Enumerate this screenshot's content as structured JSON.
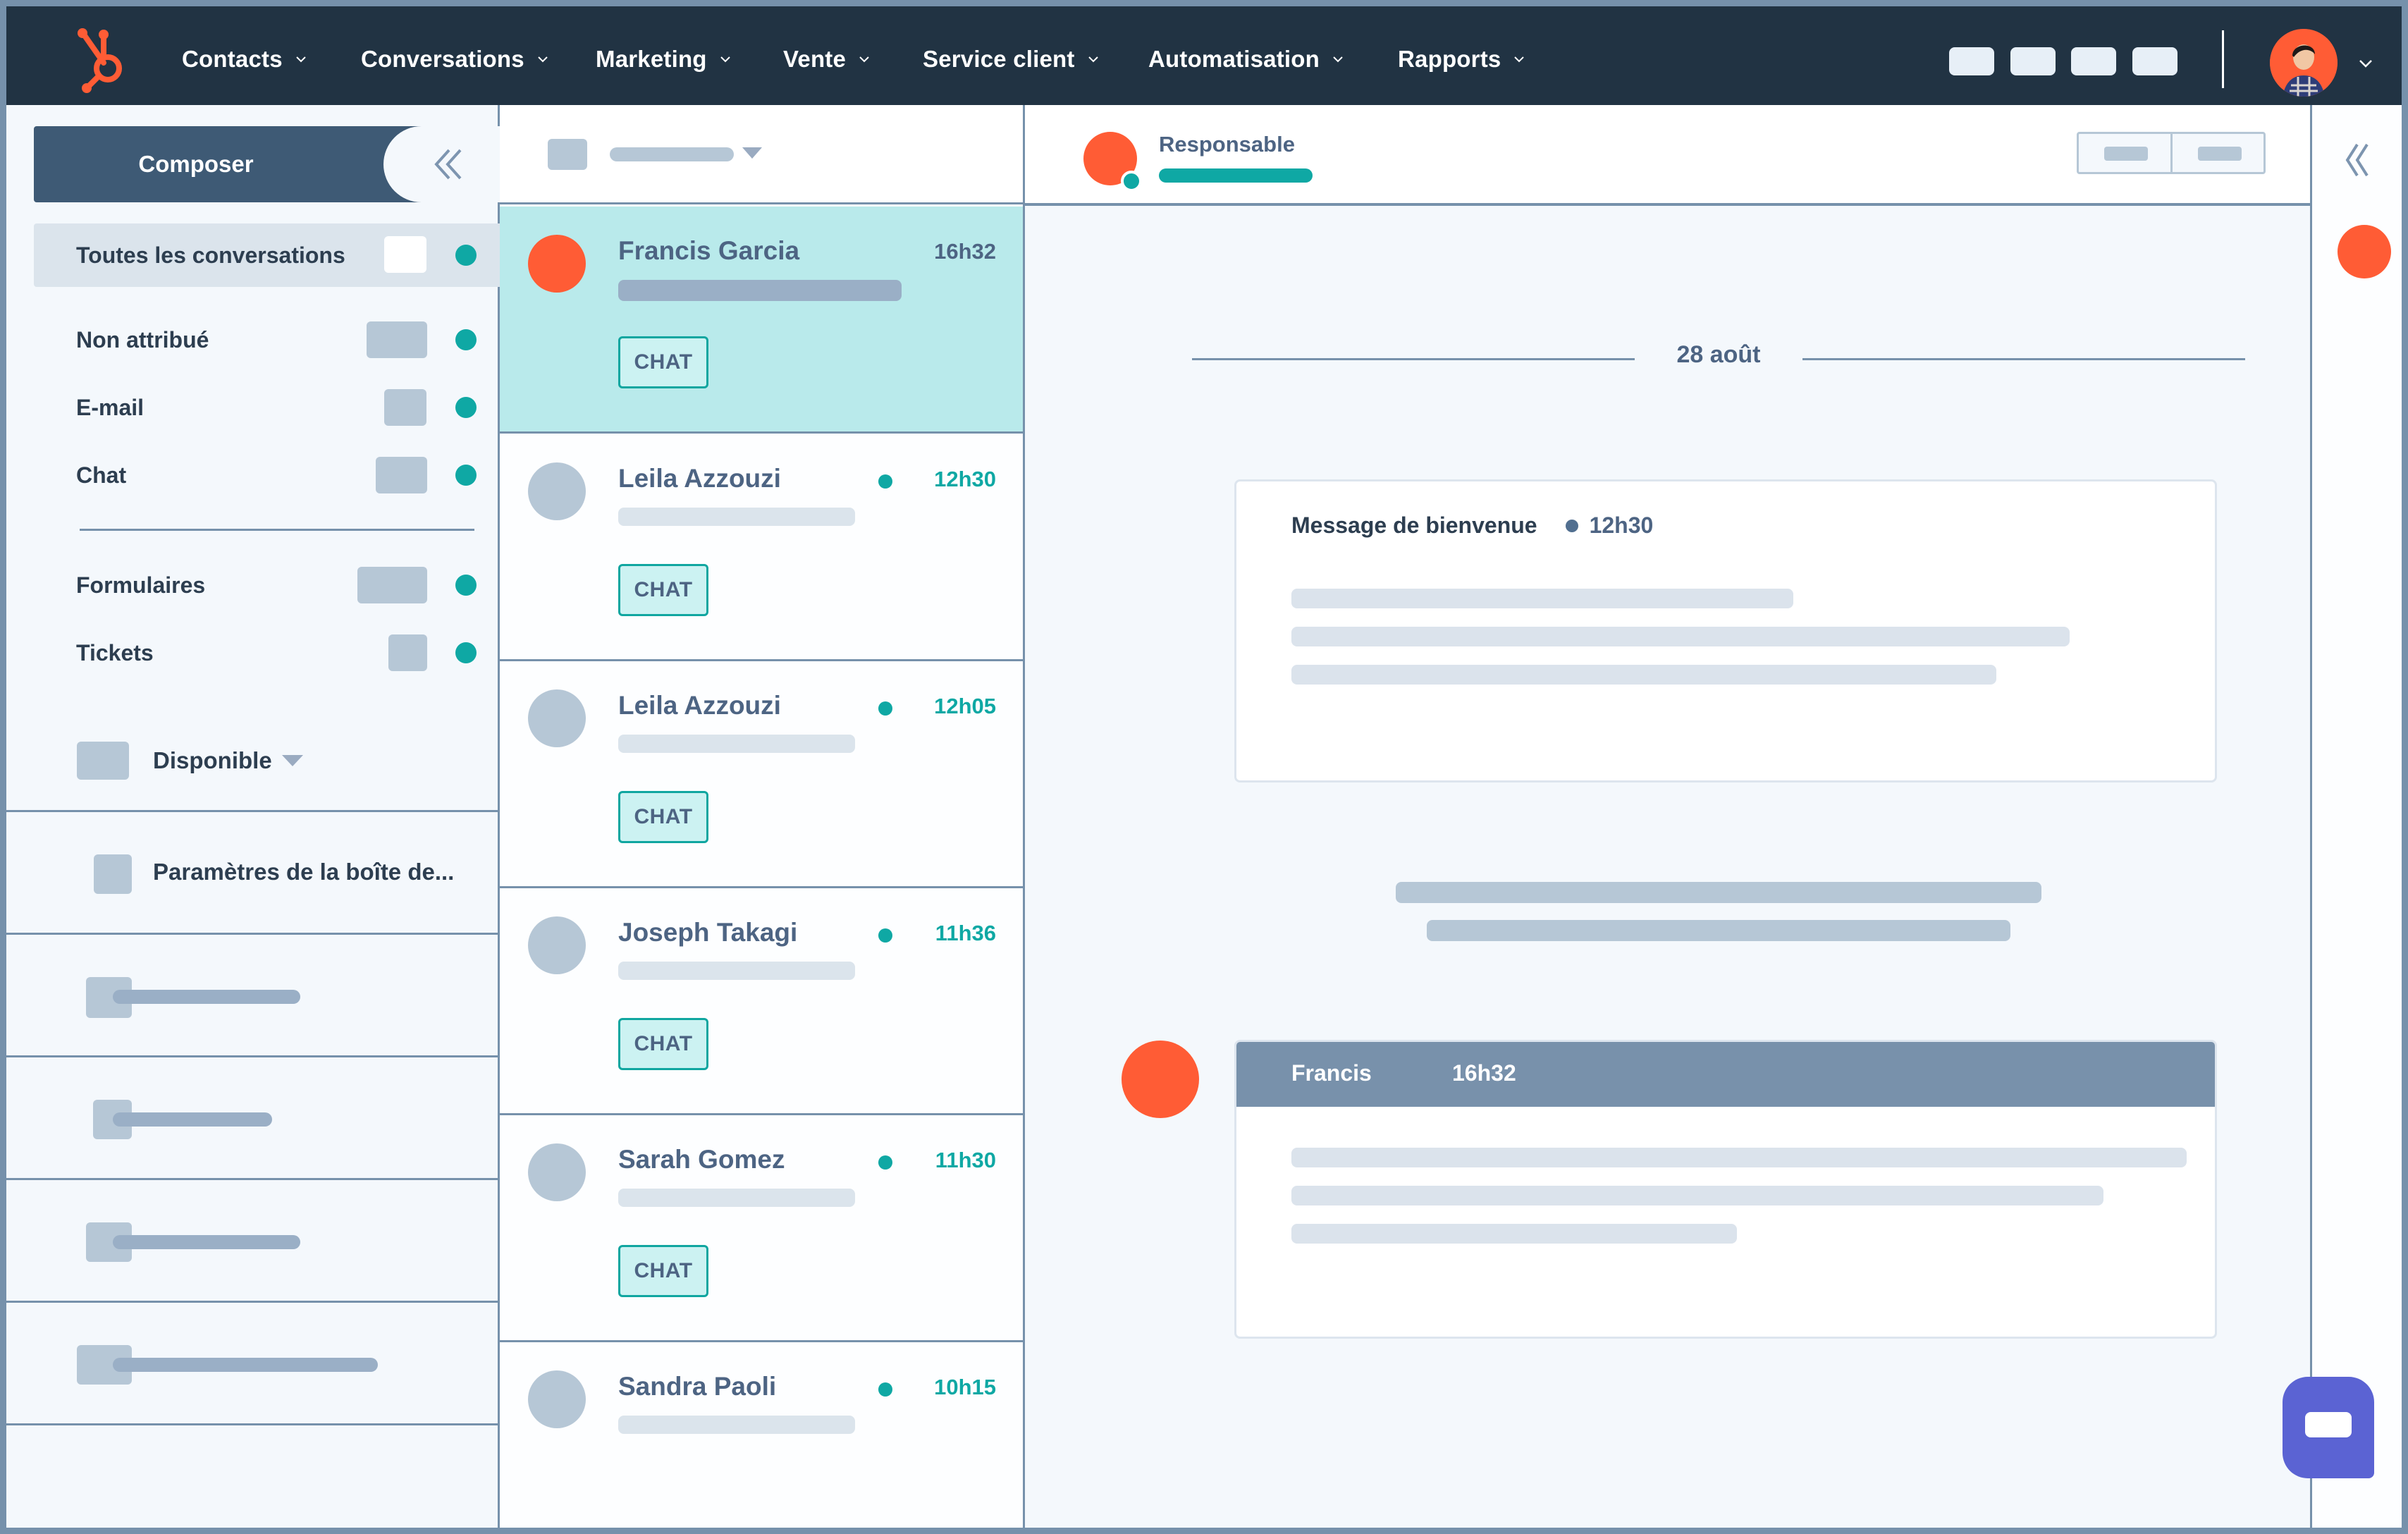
{
  "colors": {
    "brand_orange": "#ff5c35",
    "nav_bg": "#213343",
    "teal": "#0fa8a4",
    "selected_row": "#b9eaeb",
    "chat_fab": "#5b63d3"
  },
  "topnav": {
    "logo_icon": "hubspot-sprocket-icon",
    "items": [
      {
        "label": "Contacts"
      },
      {
        "label": "Conversations"
      },
      {
        "label": "Marketing"
      },
      {
        "label": "Vente"
      },
      {
        "label": "Service client"
      },
      {
        "label": "Automatisation"
      },
      {
        "label": "Rapports"
      }
    ],
    "user_avatar_icon": "user-avatar",
    "account_menu_icon": "chevron-down-icon"
  },
  "sidebar": {
    "compose_label": "Composer",
    "collapse_icon": "double-chevron-left-icon",
    "inboxes": [
      {
        "label": "Toutes les conversations",
        "active": true
      },
      {
        "label": "Non attribué",
        "active": false
      },
      {
        "label": "E-mail",
        "active": false
      },
      {
        "label": "Chat",
        "active": false
      },
      {
        "label": "Formulaires",
        "active": false
      },
      {
        "label": "Tickets",
        "active": false
      }
    ],
    "availability": {
      "label": "Disponible"
    },
    "settings_label": "Paramètres de la boîte de..."
  },
  "conversations": [
    {
      "name": "Francis Garcia",
      "time": "16h32",
      "tag": "CHAT",
      "selected": true,
      "unread": false
    },
    {
      "name": "Leila Azzouzi",
      "time": "12h30",
      "tag": "CHAT",
      "selected": false,
      "unread": true
    },
    {
      "name": "Leila Azzouzi",
      "time": "12h05",
      "tag": "CHAT",
      "selected": false,
      "unread": true
    },
    {
      "name": "Joseph Takagi",
      "time": "11h36",
      "tag": "CHAT",
      "selected": false,
      "unread": true
    },
    {
      "name": "Sarah Gomez",
      "time": "11h30",
      "tag": "CHAT",
      "selected": false,
      "unread": true
    },
    {
      "name": "Sandra Paoli",
      "time": "10h15",
      "tag": "",
      "selected": false,
      "unread": true
    }
  ],
  "thread": {
    "owner_label": "Responsable",
    "date_separator": "28 août",
    "welcome_message": {
      "title": "Message de bienvenue",
      "time": "12h30"
    },
    "reply": {
      "sender": "Francis",
      "time": "16h32"
    }
  },
  "right_rail": {
    "collapse_icon": "double-chevron-left-icon"
  },
  "chat_widget": {
    "icon": "chat-bubble-icon"
  }
}
